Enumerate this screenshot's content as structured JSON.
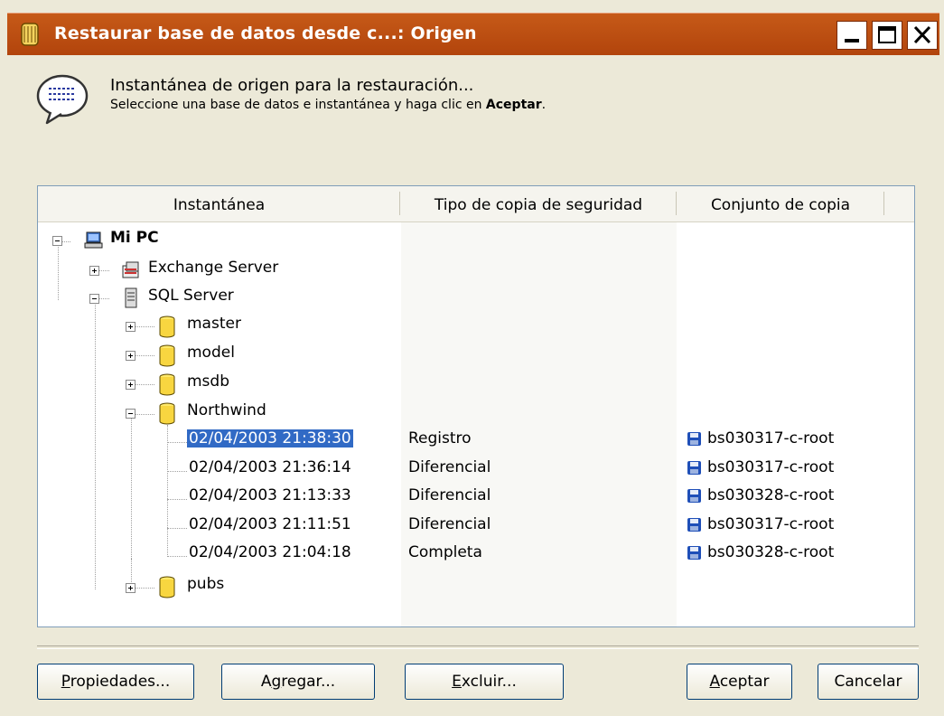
{
  "window": {
    "title": "Restaurar base de datos desde c...: Origen",
    "controls": {
      "minimize": "minimize",
      "maximize": "maximize",
      "close": "close"
    }
  },
  "header": {
    "title": "Instantánea de origen para la restauración...",
    "subtitle_prefix": "Seleccione una base de datos e instantánea y haga clic en ",
    "subtitle_bold": "Aceptar",
    "subtitle_suffix": "."
  },
  "table": {
    "columns": [
      "Instantánea",
      "Tipo de copia de seguridad",
      "Conjunto de copia"
    ],
    "tree": {
      "root": "Mi PC",
      "exchange": "Exchange Server",
      "sql": "SQL Server",
      "databases": [
        "master",
        "model",
        "msdb",
        "Northwind",
        "pubs"
      ],
      "snapshots": [
        {
          "time": "02/04/2003 21:38:30",
          "type": "Registro",
          "set": "bs030317-c-root",
          "selected": true
        },
        {
          "time": "02/04/2003 21:36:14",
          "type": "Diferencial",
          "set": "bs030317-c-root",
          "selected": false
        },
        {
          "time": "02/04/2003 21:13:33",
          "type": "Diferencial",
          "set": "bs030328-c-root",
          "selected": false
        },
        {
          "time": "02/04/2003 21:11:51",
          "type": "Diferencial",
          "set": "bs030317-c-root",
          "selected": false
        },
        {
          "time": "02/04/2003 21:04:18",
          "type": "Completa",
          "set": "bs030328-c-root",
          "selected": false
        }
      ]
    }
  },
  "buttons": {
    "properties": {
      "mnemonic": "P",
      "rest": "ropiedades..."
    },
    "add": {
      "pre": "A",
      "mnemonic": "g",
      "rest": "regar..."
    },
    "exclude": {
      "mnemonic": "E",
      "rest": "xcluir..."
    },
    "accept": {
      "mnemonic": "A",
      "rest": "ceptar"
    },
    "cancel": "Cancelar"
  },
  "colors": {
    "titlebar": "#b84a10",
    "selection": "#316ac5",
    "window_bg": "#ece9d8"
  }
}
